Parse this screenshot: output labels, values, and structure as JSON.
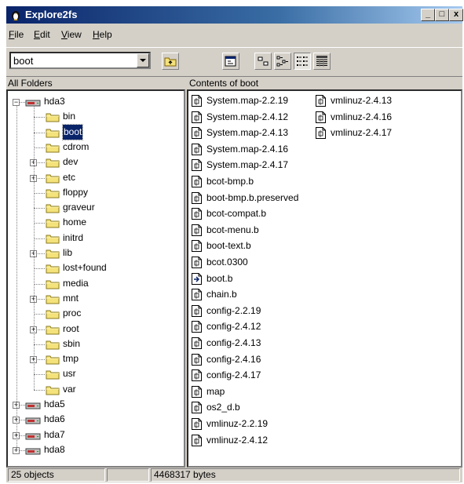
{
  "window": {
    "title": "Explore2fs"
  },
  "title_buttons": {
    "minimize": "_",
    "maximize": "□",
    "close": "x"
  },
  "menu": [
    {
      "first": "F",
      "rest": "ile"
    },
    {
      "first": "E",
      "rest": "dit"
    },
    {
      "first": "V",
      "rest": "iew"
    },
    {
      "first": "H",
      "rest": "elp"
    }
  ],
  "toolbar": {
    "location_value": "boot",
    "buttons": [
      "up-folder-icon",
      "properties-icon",
      "large-icons-view-icon",
      "small-icons-view-icon",
      "list-view-icon",
      "details-view-icon"
    ],
    "active_view": "list-view-icon"
  },
  "left_header": "All Folders",
  "right_header": "Contents of boot",
  "tree": [
    {
      "label": "hda3",
      "level": 0,
      "kind": "drive",
      "expander": "−"
    },
    {
      "label": "bin",
      "level": 1,
      "kind": "folder",
      "expander": ""
    },
    {
      "label": "boot",
      "level": 1,
      "kind": "folder",
      "expander": "",
      "selected": true
    },
    {
      "label": "cdrom",
      "level": 1,
      "kind": "folder",
      "expander": ""
    },
    {
      "label": "dev",
      "level": 1,
      "kind": "folder",
      "expander": "+"
    },
    {
      "label": "etc",
      "level": 1,
      "kind": "folder",
      "expander": "+"
    },
    {
      "label": "floppy",
      "level": 1,
      "kind": "folder",
      "expander": ""
    },
    {
      "label": "graveur",
      "level": 1,
      "kind": "folder",
      "expander": ""
    },
    {
      "label": "home",
      "level": 1,
      "kind": "folder",
      "expander": ""
    },
    {
      "label": "initrd",
      "level": 1,
      "kind": "folder",
      "expander": ""
    },
    {
      "label": "lib",
      "level": 1,
      "kind": "folder",
      "expander": "+"
    },
    {
      "label": "lost+found",
      "level": 1,
      "kind": "folder",
      "expander": ""
    },
    {
      "label": "media",
      "level": 1,
      "kind": "folder",
      "expander": ""
    },
    {
      "label": "mnt",
      "level": 1,
      "kind": "folder",
      "expander": "+"
    },
    {
      "label": "proc",
      "level": 1,
      "kind": "folder",
      "expander": ""
    },
    {
      "label": "root",
      "level": 1,
      "kind": "folder",
      "expander": "+"
    },
    {
      "label": "sbin",
      "level": 1,
      "kind": "folder",
      "expander": ""
    },
    {
      "label": "tmp",
      "level": 1,
      "kind": "folder",
      "expander": "+"
    },
    {
      "label": "usr",
      "level": 1,
      "kind": "folder",
      "expander": ""
    },
    {
      "label": "var",
      "level": 1,
      "kind": "folder",
      "expander": ""
    },
    {
      "label": "hda5",
      "level": 0,
      "kind": "drive",
      "expander": "+"
    },
    {
      "label": "hda6",
      "level": 0,
      "kind": "drive",
      "expander": "+"
    },
    {
      "label": "hda7",
      "level": 0,
      "kind": "drive",
      "expander": "+"
    },
    {
      "label": "hda8",
      "level": 0,
      "kind": "drive",
      "expander": "+"
    }
  ],
  "files": [
    {
      "name": "System.map-2.2.19",
      "icon": "file-icon"
    },
    {
      "name": "System.map-2.4.12",
      "icon": "file-icon"
    },
    {
      "name": "System.map-2.4.13",
      "icon": "file-icon"
    },
    {
      "name": "System.map-2.4.16",
      "icon": "file-icon"
    },
    {
      "name": "System.map-2.4.17",
      "icon": "file-icon"
    },
    {
      "name": "bcot-bmp.b",
      "icon": "file-icon"
    },
    {
      "name": "boot-bmp.b.preserved",
      "icon": "file-icon"
    },
    {
      "name": "bcot-compat.b",
      "icon": "file-icon"
    },
    {
      "name": "bcot-menu.b",
      "icon": "file-icon"
    },
    {
      "name": "boot-text.b",
      "icon": "file-icon"
    },
    {
      "name": "bcot.0300",
      "icon": "file-icon"
    },
    {
      "name": "boot.b",
      "icon": "link-file-icon"
    },
    {
      "name": "chain.b",
      "icon": "file-icon"
    },
    {
      "name": "config-2.2.19",
      "icon": "file-icon"
    },
    {
      "name": "config-2.4.12",
      "icon": "file-icon"
    },
    {
      "name": "config-2.4.13",
      "icon": "file-icon"
    },
    {
      "name": "config-2.4.16",
      "icon": "file-icon"
    },
    {
      "name": "config-2.4.17",
      "icon": "file-icon"
    },
    {
      "name": "map",
      "icon": "file-icon"
    },
    {
      "name": "os2_d.b",
      "icon": "file-icon"
    },
    {
      "name": "vmlinuz-2.2.19",
      "icon": "file-icon"
    },
    {
      "name": "vmlinuz-2.4.12",
      "icon": "file-icon"
    },
    {
      "name": "vmlinuz-2.4.13",
      "icon": "file-icon"
    },
    {
      "name": "vmlinuz-2.4.16",
      "icon": "file-icon"
    },
    {
      "name": "vmlinuz-2.4.17",
      "icon": "file-icon"
    }
  ],
  "status": {
    "count": "25 objects",
    "middle": "",
    "size": "4468317 bytes"
  },
  "colors": {
    "titlebar": "#0a246a",
    "selection": "#0a246a",
    "folder": "#f4e27a",
    "drive": "#c03030"
  }
}
